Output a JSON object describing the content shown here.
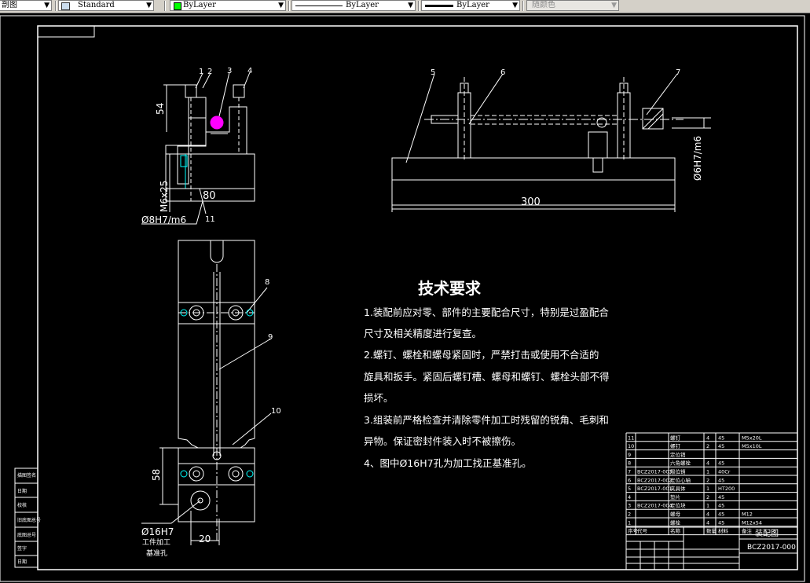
{
  "toolbar": {
    "cut_label": "剖图",
    "text_style": "Standard",
    "layer_color": "ByLayer",
    "layer_color_swatch": "#00ff00",
    "linetype": "ByLayer",
    "lineweight": "ByLayer",
    "plot_style": "随颜色"
  },
  "drawing": {
    "dims": {
      "d54": "54",
      "d80": "80",
      "m6x25": "M6x25",
      "fit_8": "Ø8H7/m6",
      "d300": "300",
      "fit_6": "Ø6H7/m6",
      "d58": "58",
      "fit_16": "Ø16H7",
      "d20": "20"
    },
    "note_lines": [
      "工件加工",
      "基准孔"
    ],
    "balloons": [
      "1",
      "2",
      "3",
      "4",
      "5",
      "6",
      "7",
      "8",
      "9",
      "10",
      "11"
    ],
    "tech_title": "技术要求",
    "tech_lines": [
      "1.装配前应对零、部件的主要配合尺寸，特别是过盈配合",
      "尺寸及相关精度进行复查。",
      "2.螺钉、螺栓和螺母紧固时，严禁打击或使用不合适的",
      "旋具和扳手。紧固后螺钉槽、螺母和螺钉、螺栓头部不得",
      "损坏。",
      "3.组装前严格检查并清除零件加工时残留的锐角、毛刺和",
      "异物。保证密封件装入时不被擦伤。",
      "4、图中Ø16H7孔为加工找正基准孔。"
    ],
    "bom": [
      {
        "no": "11",
        "code": "",
        "name": "螺钉",
        "qty": "4",
        "mat": "45",
        "note": "M5x20L"
      },
      {
        "no": "10",
        "code": "",
        "name": "螺钉",
        "qty": "2",
        "mat": "45",
        "note": "M5x10L"
      },
      {
        "no": "9",
        "code": "",
        "name": "定位销",
        "qty": "",
        "mat": "",
        "note": ""
      },
      {
        "no": "8",
        "code": "",
        "name": "六角螺栓",
        "qty": "4",
        "mat": "45",
        "note": ""
      },
      {
        "no": "7",
        "code": "BCZ2017-003",
        "name": "限位销",
        "qty": "1",
        "mat": "40Cr",
        "note": ""
      },
      {
        "no": "6",
        "code": "BCZ2017-002",
        "name": "定位心轴",
        "qty": "2",
        "mat": "45",
        "note": ""
      },
      {
        "no": "5",
        "code": "BCZ2017-001",
        "name": "夹具体",
        "qty": "1",
        "mat": "HT200",
        "note": ""
      },
      {
        "no": "4",
        "code": "",
        "name": "垫片",
        "qty": "2",
        "mat": "45",
        "note": ""
      },
      {
        "no": "3",
        "code": "BCZ2017-004",
        "name": "定位块",
        "qty": "1",
        "mat": "45",
        "note": ""
      },
      {
        "no": "2",
        "code": "",
        "name": "螺母",
        "qty": "4",
        "mat": "45",
        "note": "M12"
      },
      {
        "no": "1",
        "code": "",
        "name": "螺栓",
        "qty": "4",
        "mat": "45",
        "note": "M12x54"
      }
    ],
    "bom_header": {
      "no": "序号",
      "code": "代号",
      "name": "名称",
      "qty": "数量",
      "mat": "材料",
      "note": "备注"
    },
    "title_block": {
      "title": "装配图",
      "drawing_no": "BCZ2017-000"
    },
    "left_strip": [
      "描图签名",
      "日期",
      "校核",
      "旧底图总号",
      "底图总号",
      "签字",
      "日期"
    ]
  }
}
